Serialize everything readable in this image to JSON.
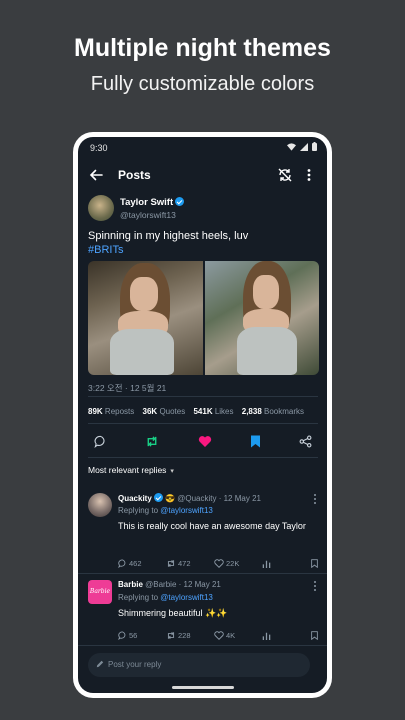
{
  "promo": {
    "title": "Multiple night themes",
    "subtitle": "Fully customizable colors"
  },
  "status_bar": {
    "time": "9:30"
  },
  "app_bar": {
    "title": "Posts"
  },
  "post": {
    "author_name": "Taylor Swift",
    "author_handle": "@taylorswift13",
    "text": "Spinning in my highest heels, luv",
    "hashtag": "#BRITs",
    "timestamp": "3:22 오전 · 12 5월 21",
    "stats": {
      "reposts_count": "89K",
      "reposts_label": "Reposts",
      "quotes_count": "36K",
      "quotes_label": "Quotes",
      "likes_count": "541K",
      "likes_label": "Likes",
      "bookmarks_count": "2,838",
      "bookmarks_label": "Bookmarks"
    }
  },
  "replies_header": {
    "label": "Most relevant replies"
  },
  "replies": [
    {
      "name": "Quackity",
      "emoji": "😎",
      "handle": "@Quackity",
      "date": "· 12 May 21",
      "replying_prefix": "Replying to",
      "replying_handle": "@taylorswift13",
      "text": "This is really cool have an awesome day Taylor",
      "replies": "462",
      "reposts": "472",
      "likes": "22K"
    },
    {
      "name": "Barbie",
      "avatar_text": "Barbie",
      "handle": "@Barbie",
      "date": "· 12 May 21",
      "replying_prefix": "Replying to",
      "replying_handle": "@taylorswift13",
      "text": "Shimmering beautiful ✨✨",
      "replies": "56",
      "reposts": "228",
      "likes": "4K"
    }
  ],
  "reply_input": {
    "placeholder": "Post your reply"
  },
  "colors": {
    "background": "#3a3d40",
    "screen": "#151c25",
    "accent_blue": "#4da3ff",
    "retweet_green": "#19cf86",
    "like_pink": "#f91880",
    "bookmark_blue": "#1d9bf0"
  },
  "icons": [
    "arrow-back-icon",
    "sync-off-icon",
    "more-vert-icon",
    "reply-icon",
    "repost-icon",
    "heart-icon",
    "bookmark-icon",
    "share-icon",
    "chart-icon",
    "pen-icon"
  ]
}
